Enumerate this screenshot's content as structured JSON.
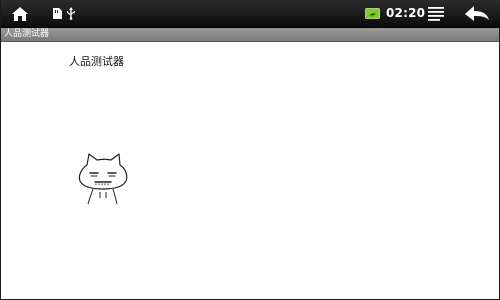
{
  "status_bar": {
    "time": "02:20",
    "icons": {
      "home": "home-icon",
      "sd_card": "sd-card-icon",
      "usb": "usb-icon",
      "battery": "battery-icon",
      "menu": "menu-icon",
      "back": "back-arrow-icon"
    },
    "colors": {
      "background": "#111111",
      "battery": "#7ecb2a",
      "icon": "#ffffff"
    }
  },
  "title_bar": {
    "title": "人品测试器"
  },
  "main": {
    "label": "人品测试器"
  }
}
